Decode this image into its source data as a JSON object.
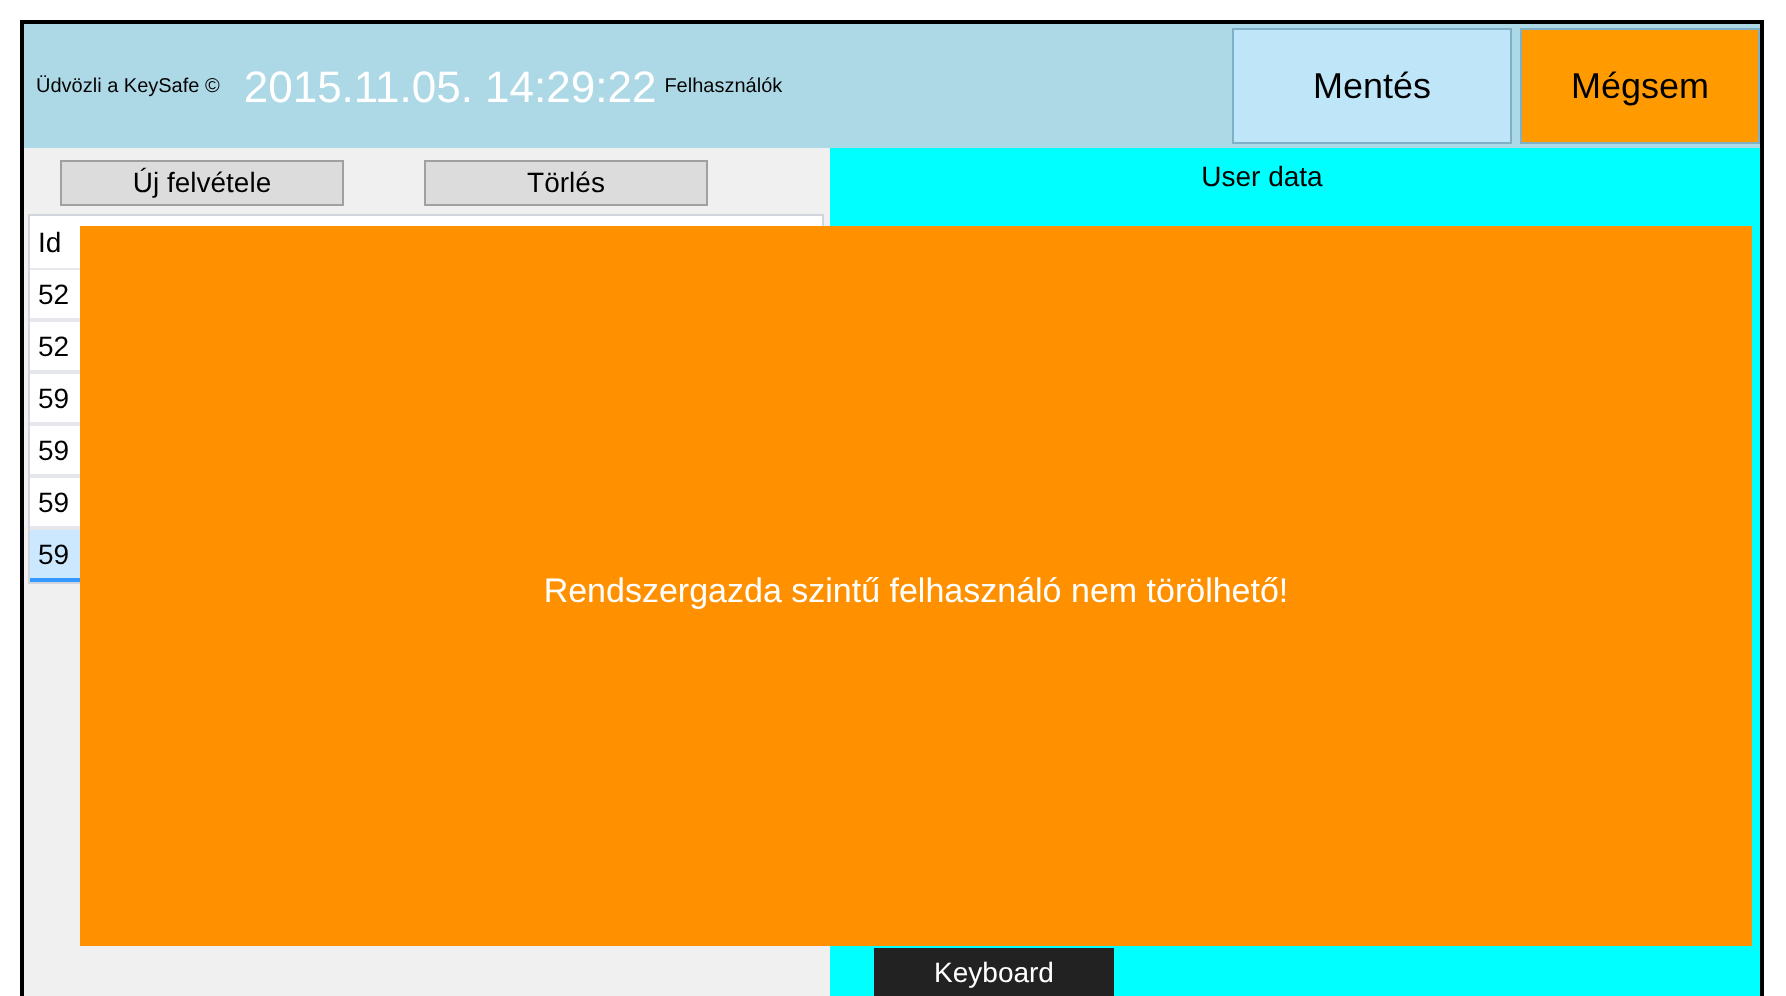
{
  "header": {
    "welcome": "Üdvözli a KeySafe ©",
    "datetime": "2015.11.05. 14:29:22",
    "section": "Felhasználók",
    "buttons": [
      {
        "label": "Mentés",
        "kind": "save"
      },
      {
        "label": "Mégsem",
        "kind": "cancel"
      }
    ]
  },
  "left_panel": {
    "buttons": [
      "Új felvétele",
      "Törlés"
    ],
    "table": {
      "columns": [
        "Id"
      ],
      "rows": [
        {
          "cells": [
            "52"
          ],
          "selected": false
        },
        {
          "cells": [
            "52"
          ],
          "selected": false
        },
        {
          "cells": [
            "59"
          ],
          "selected": false
        },
        {
          "cells": [
            "59"
          ],
          "selected": false
        },
        {
          "cells": [
            "59"
          ],
          "selected": false
        },
        {
          "cells": [
            "59"
          ],
          "selected": true
        }
      ]
    }
  },
  "user_data": {
    "title": "User data",
    "keyboard_button": "Keyboard"
  },
  "message": {
    "text": "Rendszergazda szintű felhasználó nem törölhető!"
  }
}
